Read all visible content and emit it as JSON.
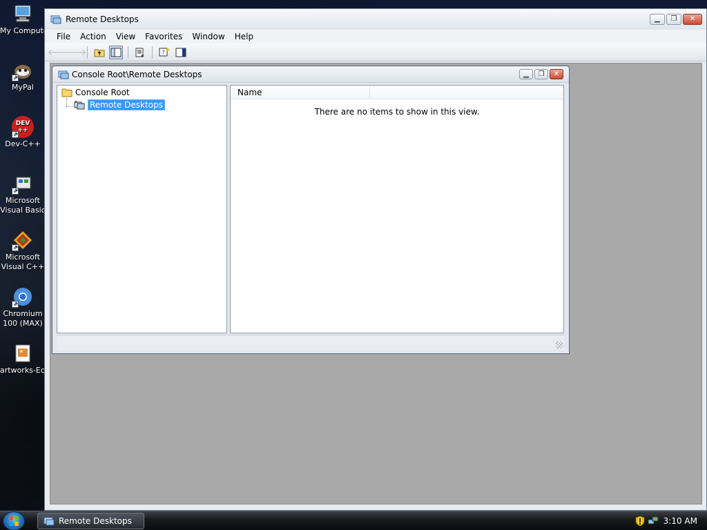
{
  "desktop": {
    "icons": [
      {
        "label": "My Computer",
        "icon": "computer-icon"
      },
      {
        "label": "MyPal",
        "icon": "mypal-icon"
      },
      {
        "label": "Dev-C++",
        "icon": "devcpp-icon",
        "glyph": "DEV\n++"
      },
      {
        "label": "Microsoft Visual Basic",
        "icon": "visual-basic-icon"
      },
      {
        "label": "Microsoft Visual C++",
        "icon": "visual-cpp-icon"
      },
      {
        "label": "Chromium 100 (MAX)",
        "icon": "chromium-icon"
      },
      {
        "label": "artworks-Ec...",
        "icon": "image-file-icon"
      }
    ]
  },
  "main_window": {
    "title": "Remote Desktops",
    "menu": [
      "File",
      "Action",
      "View",
      "Favorites",
      "Window",
      "Help"
    ],
    "toolbar": [
      {
        "icon": "back-arrow-icon",
        "enabled": false
      },
      {
        "icon": "forward-arrow-icon",
        "enabled": false
      },
      {
        "icon": "up-one-level-icon",
        "enabled": true
      },
      {
        "icon": "show-hide-console-tree-icon",
        "enabled": true,
        "pressed": true
      },
      {
        "icon": "export-list-icon",
        "enabled": true
      },
      {
        "icon": "help-icon",
        "enabled": true
      },
      {
        "icon": "show-hide-action-pane-icon",
        "enabled": true
      }
    ]
  },
  "child_window": {
    "title": "Console Root\\Remote Desktops",
    "tree": {
      "root": "Console Root",
      "child": "Remote Desktops"
    },
    "list": {
      "columns": [
        "Name",
        ""
      ],
      "empty_message": "There are no items to show in this view."
    }
  },
  "taskbar": {
    "task": "Remote Desktops",
    "clock": "3:10 AM"
  },
  "colors": {
    "selection": "#3399ff",
    "mdi_background": "#a9a9a9"
  }
}
